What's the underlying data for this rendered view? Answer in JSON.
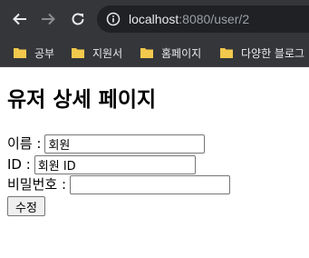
{
  "browser": {
    "url_host": "localhost",
    "url_rest": ":8080/user/2",
    "icons": {
      "back": "arrow-left-icon",
      "forward": "arrow-right-icon",
      "reload": "reload-icon",
      "site_info": "info-icon",
      "bookmark": "folder-icon"
    },
    "colors": {
      "toolbar_bg": "#35363a",
      "omnibox_bg": "#202124",
      "folder_yellow": "#f2c94c"
    }
  },
  "bookmarks": [
    {
      "label": "공부"
    },
    {
      "label": "지원서"
    },
    {
      "label": "홈페이지"
    },
    {
      "label": "다양한 블로그"
    }
  ],
  "page": {
    "title": "유저 상세 페이지",
    "form": {
      "name_label": "이름 :",
      "name_value": "회원",
      "id_label": "ID :",
      "id_value": "회원 ID",
      "password_label": "비밀번호 :",
      "password_value": "",
      "submit_label": "수정"
    }
  }
}
